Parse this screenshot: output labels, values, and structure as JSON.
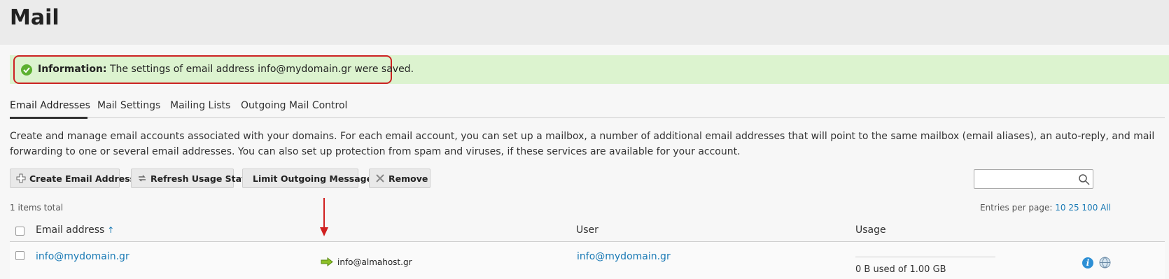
{
  "page": {
    "title": "Mail"
  },
  "message": {
    "label": "Information:",
    "text": "The settings of email address info@mydomain.gr were saved."
  },
  "tabs": [
    {
      "label": "Email Addresses",
      "active": true
    },
    {
      "label": "Mail Settings",
      "active": false
    },
    {
      "label": "Mailing Lists",
      "active": false
    },
    {
      "label": "Outgoing Mail Control",
      "active": false
    }
  ],
  "description": "Create and manage email accounts associated with your domains. For each email account, you can set up a mailbox, a number of additional email addresses that will point to the same mailbox (email aliases), an auto-reply, and mail forwarding to one or several email addresses. You can also set up protection from spam and viruses, if these services are available for your account.",
  "toolbar": {
    "create_label": "Create Email Address",
    "refresh_label": "Refresh Usage Stats",
    "limit_label": "Limit Outgoing Messages",
    "remove_label": "Remove"
  },
  "search": {
    "value": ""
  },
  "list": {
    "items_total": "1 items total",
    "entries_label": "Entries per page:",
    "entries_options": [
      "10",
      "25",
      "100",
      "All"
    ]
  },
  "table": {
    "columns": {
      "email": "Email address",
      "user": "User",
      "usage": "Usage"
    },
    "rows": [
      {
        "email": "info@mydomain.gr",
        "forward": "info@almahost.gr",
        "user": "info@mydomain.gr",
        "usage": "0 B used of 1.00 GB"
      }
    ]
  },
  "colors": {
    "accent_link": "#1a7ab5",
    "success_bg": "#dcf3cf",
    "success_icon": "#5cb030",
    "highlight_red": "#cc2222"
  },
  "icons": {
    "check": "check-circle-icon",
    "create": "plus-icon",
    "refresh": "refresh-icon",
    "remove": "x-icon",
    "search": "search-icon",
    "forward": "forward-arrow-icon",
    "info": "info-icon",
    "globe": "globe-icon"
  }
}
